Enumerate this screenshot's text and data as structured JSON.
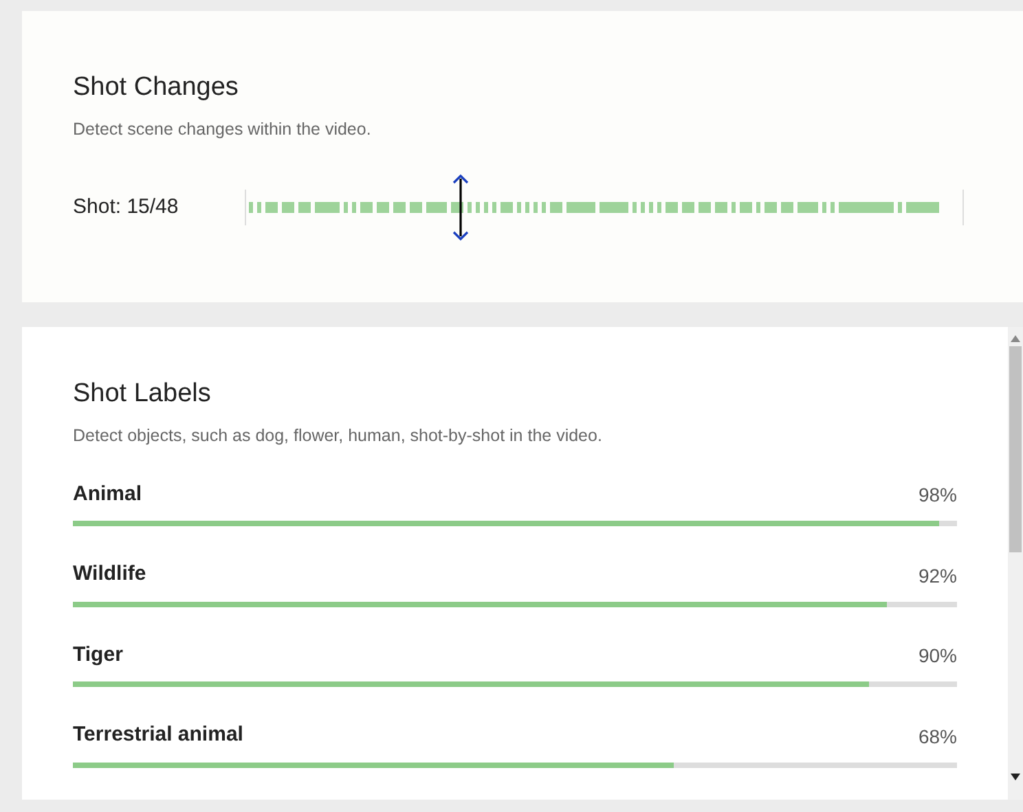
{
  "shot_changes": {
    "title": "Shot Changes",
    "description": "Detect scene changes within the video.",
    "shot_label": "Shot: 15/48",
    "timeline": {
      "level": 0.3
    }
  },
  "shot_labels": {
    "title": "Shot Labels",
    "description": "Detect objects, such as dog, flower, human, shot-by-shot in the video.",
    "labels": [
      {
        "name": "Animal",
        "percent": "98%",
        "level": 0.98
      },
      {
        "name": "Wildlife",
        "percent": "92%",
        "level": 0.92
      },
      {
        "name": "Tiger",
        "percent": "90%",
        "level": 0.9
      },
      {
        "name": "Terrestrial animal",
        "percent": "68%",
        "level": 0.68
      }
    ]
  }
}
